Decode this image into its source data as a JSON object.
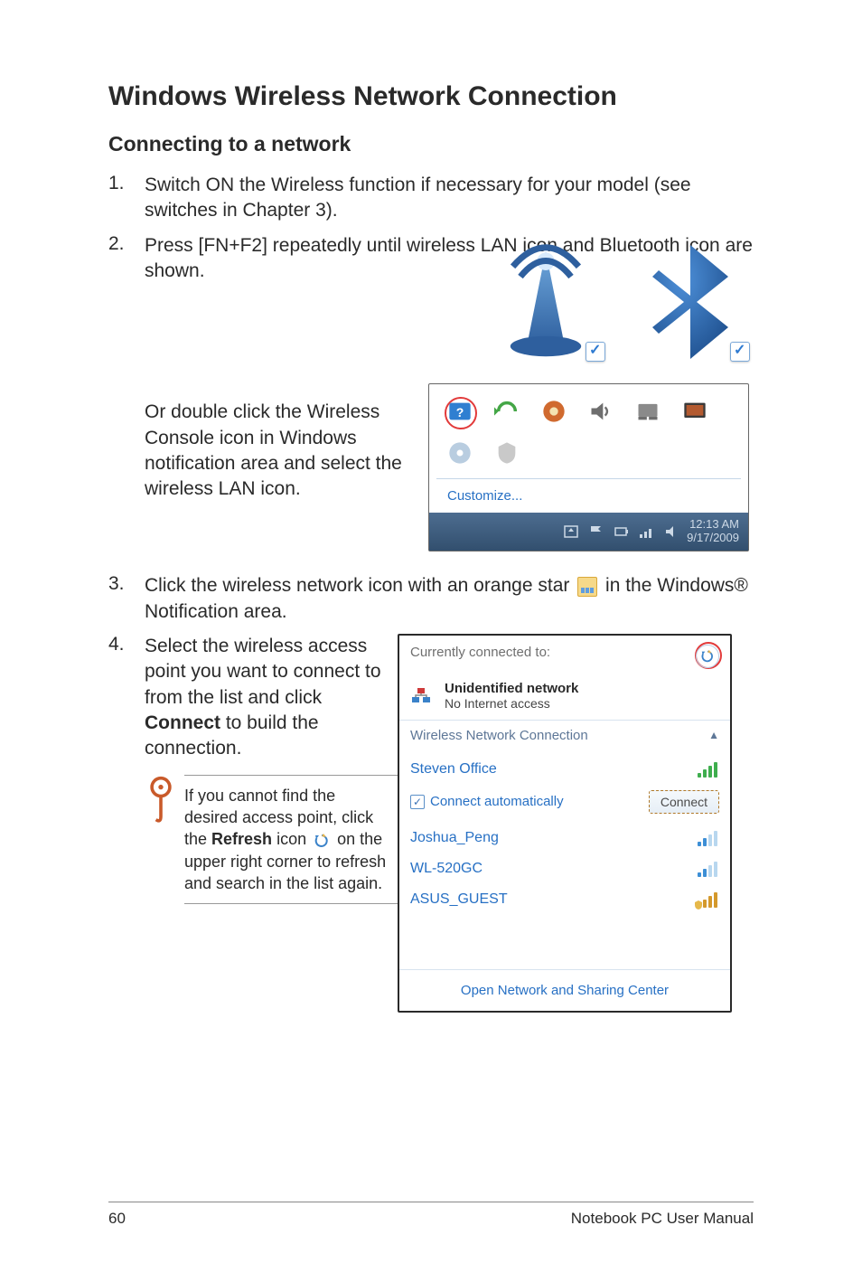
{
  "heading": "Windows Wireless Network Connection",
  "subheading": "Connecting to a network",
  "steps": {
    "s1": {
      "num": "1.",
      "text": "Switch ON the Wireless function if necessary for your model (see switches in Chapter 3)."
    },
    "s2": {
      "num": "2.",
      "text": "Press [FN+F2] repeatedly until wireless LAN icon and Bluetooth icon are shown."
    },
    "s2b": "Or double click the Wireless Console icon in Windows notification area and select the wireless LAN icon.",
    "s3": {
      "num": "3.",
      "pre": "Click the wireless network icon with an orange star ",
      "post": " in the Windows® Notification area."
    },
    "s4": {
      "num": "4.",
      "pre": "Select the wireless access point you want to connect to from the list and click ",
      "bold": "Connect",
      "post": " to build the connection."
    }
  },
  "tip": {
    "pre": "If you cannot find the desired access point, click the ",
    "bold": "Refresh",
    "mid": " icon ",
    "post": " on the upper right corner to refresh and search in the list again."
  },
  "tray": {
    "customize": "Customize...",
    "time": "12:13 AM",
    "date": "9/17/2009"
  },
  "wifi": {
    "connected_label": "Currently connected to:",
    "net_name": "Unidentified network",
    "net_status": "No Internet access",
    "section": "Wireless Network Connection",
    "auto": "Connect automatically",
    "connect": "Connect",
    "items": [
      "Steven Office",
      "Joshua_Peng",
      "WL-520GC",
      "ASUS_GUEST"
    ],
    "footer": "Open Network and Sharing Center"
  },
  "footer": {
    "page": "60",
    "title": "Notebook PC User Manual"
  }
}
